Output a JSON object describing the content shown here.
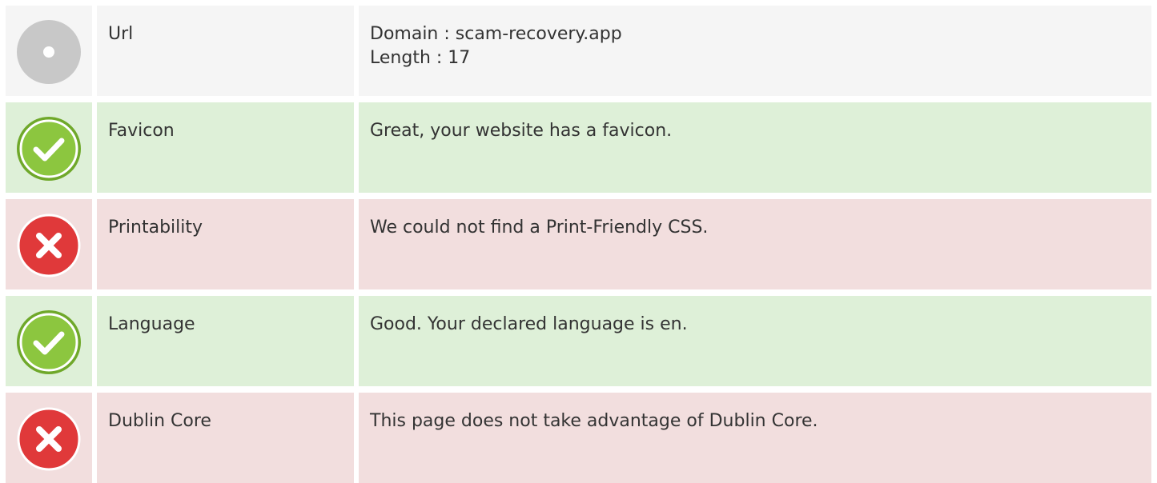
{
  "colors": {
    "neutral_bg": "#f5f5f5",
    "pass_bg": "#def0d8",
    "fail_bg": "#f2dede",
    "text": "#333333",
    "pass_icon": "#8cc63f",
    "fail_icon": "#e0393a",
    "neutral_icon": "#c8c8c8"
  },
  "rows": [
    {
      "status": "neutral",
      "icon": "neutral-dot-icon",
      "label": "Url",
      "lines": [
        "Domain : scam-recovery.app",
        "Length : 17"
      ]
    },
    {
      "status": "pass",
      "icon": "check-icon",
      "label": "Favicon",
      "lines": [
        "Great, your website has a favicon."
      ]
    },
    {
      "status": "fail",
      "icon": "cross-icon",
      "label": "Printability",
      "lines": [
        "We could not find a Print-Friendly CSS."
      ]
    },
    {
      "status": "pass",
      "icon": "check-icon",
      "label": "Language",
      "lines": [
        "Good. Your declared language is en."
      ]
    },
    {
      "status": "fail",
      "icon": "cross-icon",
      "label": "Dublin Core",
      "lines": [
        "This page does not take advantage of Dublin Core."
      ]
    }
  ]
}
